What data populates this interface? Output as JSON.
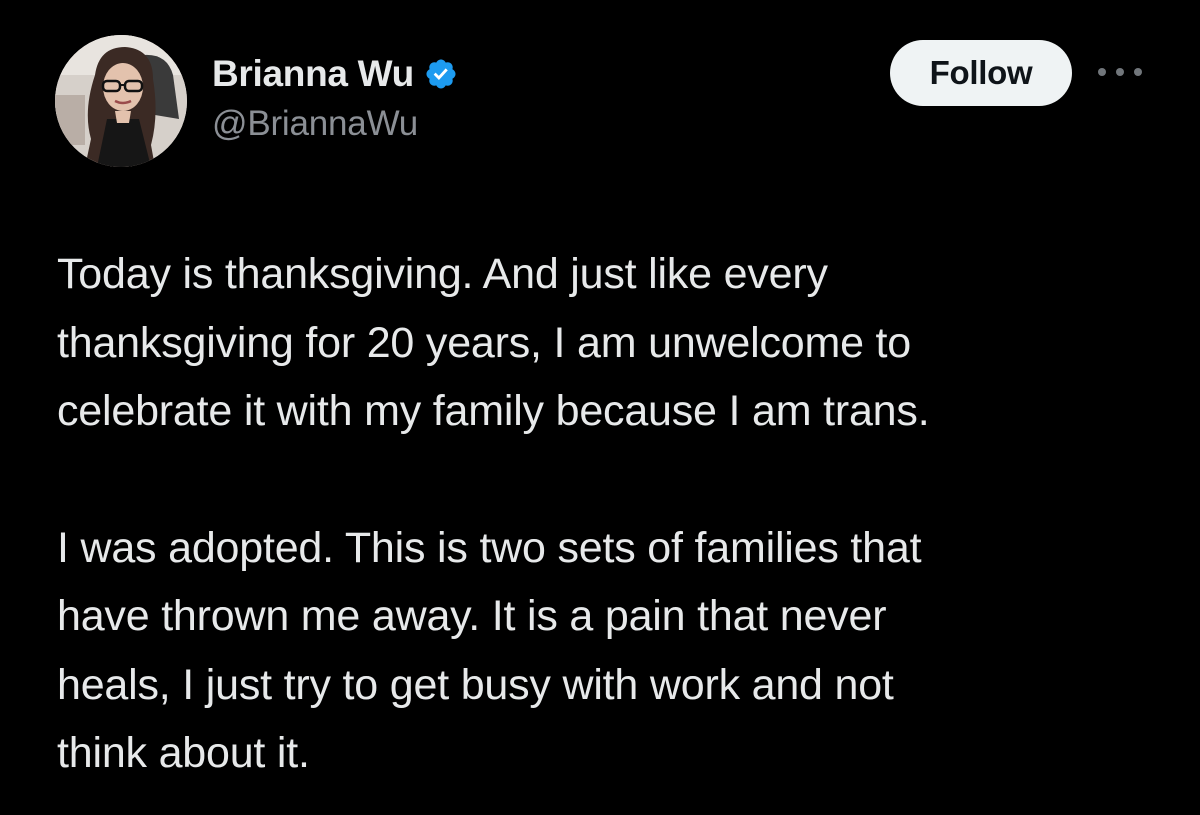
{
  "author": {
    "display_name": "Brianna Wu",
    "handle": "@BriannaWu",
    "verified": true,
    "verified_icon": "verified-badge-icon",
    "avatar_icon": "profile-photo"
  },
  "actions": {
    "follow_label": "Follow",
    "more_icon": "more-options-icon"
  },
  "tweet": {
    "paragraphs": [
      {
        "lines": [
          "Today is thanksgiving. And just like every",
          "thanksgiving for 20 years, I am unwelcome to",
          "celebrate it with my family because I am trans."
        ]
      },
      {
        "lines": [
          "I was adopted. This is two sets of families that",
          "have thrown me away. It is a pain that never",
          "heals, I just try to get busy with work and not",
          "think about it."
        ]
      }
    ]
  },
  "colors": {
    "background": "#000000",
    "text": "#e7e9ea",
    "secondary_text": "#8b8f95",
    "verified_blue": "#1d9bf0",
    "follow_bg": "#eff3f4",
    "follow_text": "#0f1419"
  }
}
